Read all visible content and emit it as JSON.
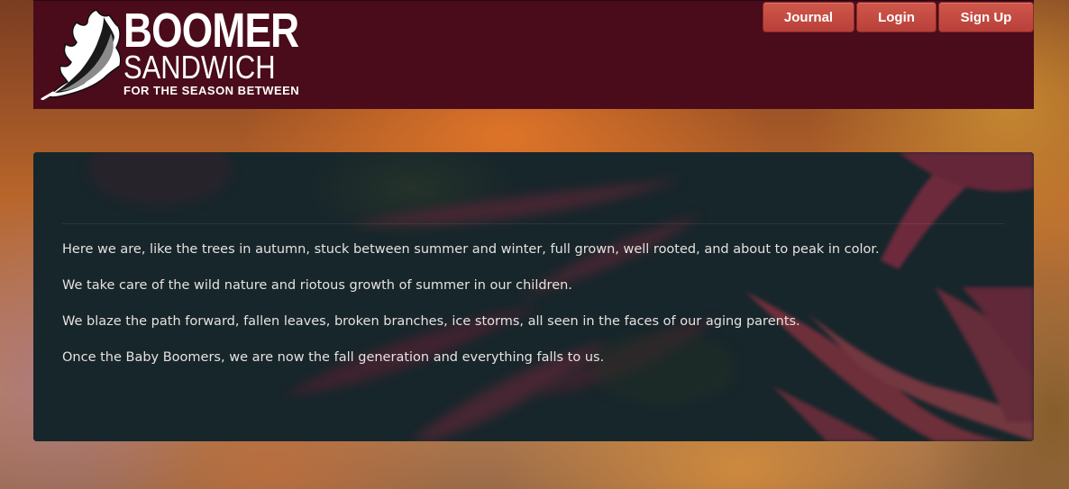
{
  "header": {
    "logo": {
      "line1": "BOOMER",
      "line2": "SANDWICH",
      "tagline": "FOR THE SEASON BETWEEN",
      "icon": "oak-leaf-icon"
    },
    "nav": {
      "journal": "Journal",
      "login": "Login",
      "signup": "Sign Up"
    }
  },
  "hero": {
    "paragraphs": [
      "Here we are, like the trees in autumn, stuck between summer and winter, full grown, well rooted, and about to peak in color.",
      "We take care of the wild nature and riotous growth of summer in our children.",
      "We blaze the path forward, fallen leaves, broken branches, ice storms, all seen in the faces of our aging parents.",
      "Once the Baby Boomers, we are now the fall generation and everything falls to us."
    ]
  },
  "colors": {
    "header_bg": "#4a0b1a",
    "button_bg": "#c34a40",
    "hero_bg": "#17282c",
    "text": "#e6e2df"
  }
}
